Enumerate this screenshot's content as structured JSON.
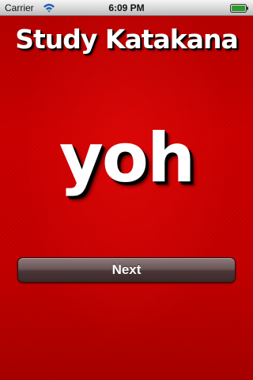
{
  "status_bar": {
    "carrier": "Carrier",
    "time": "6:09 PM",
    "signal_icon": "wifi-icon",
    "battery_icon": "battery-icon",
    "battery_level": 1.0
  },
  "app": {
    "title": "Study Katakana",
    "word": "yoh",
    "next_label": "Next"
  },
  "colors": {
    "background": "#c80000",
    "text": "#ffffff",
    "button": "#5a4646"
  }
}
